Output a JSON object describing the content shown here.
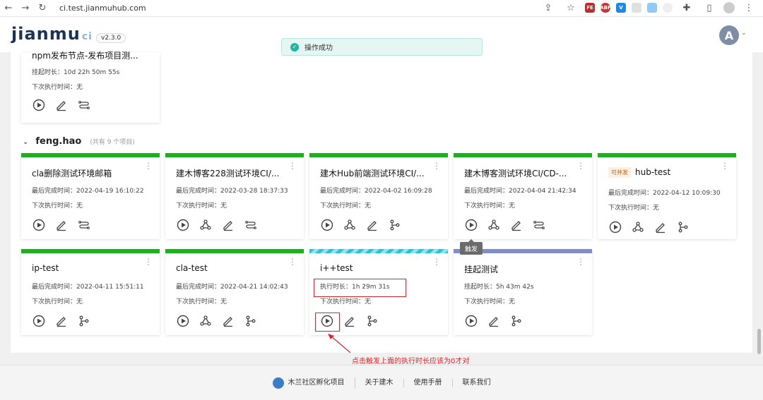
{
  "browser": {
    "url": "ci.test.jianmuhub.com"
  },
  "header": {
    "logo": "jianmu",
    "logo_ci": "ci",
    "version": "v2.3.0",
    "avatar": "A"
  },
  "toast": {
    "text": "操作成功"
  },
  "labels": {
    "last_done": "最后完成时间：",
    "next_run": "下次执行时间：",
    "suspend": "挂起时长：",
    "exec": "执行时长："
  },
  "top_card": {
    "title": "npm发布节点-发布项目测...",
    "suspend": "10d 22h 50m 55s",
    "next": "无"
  },
  "group": {
    "name": "feng.hao",
    "count": "(共有 9 个项目)"
  },
  "cards": [
    {
      "title": "cla删除测试环境邮箱",
      "status": "success",
      "line1_label": "最后完成时间：",
      "line1": "2022-04-19 16:10:22",
      "next": "无",
      "actions": [
        "play",
        "edit",
        "flow"
      ]
    },
    {
      "title": "建木博客228测试环境CI/...",
      "status": "success",
      "line1_label": "最后完成时间：",
      "line1": "2022-03-28 18:37:33",
      "next": "无",
      "actions": [
        "play",
        "webhook",
        "edit",
        "flow"
      ]
    },
    {
      "title": "建木Hub前端测试环境CI/...",
      "status": "success",
      "line1_label": "最后完成时间：",
      "line1": "2022-04-02 16:09:28",
      "next": "无",
      "actions": [
        "play",
        "webhook",
        "edit",
        "branch"
      ]
    },
    {
      "title": "建木博客测试环境CI/CD-...",
      "status": "success",
      "line1_label": "最后完成时间：",
      "line1": "2022-04-04 21:42:34",
      "next": "无",
      "actions": [
        "play",
        "webhook",
        "edit",
        "flow"
      ]
    },
    {
      "title": "hub-test",
      "badge": "可并发",
      "status": "success",
      "line1_label": "最后完成时间：",
      "line1": "2022-04-12 10:09:30",
      "next": "无",
      "actions": [
        "play",
        "webhook",
        "edit",
        "branch"
      ]
    },
    {
      "title": "ip-test",
      "status": "success",
      "line1_label": "最后完成时间：",
      "line1": "2022-04-11 15:51:11",
      "next": "无",
      "actions": [
        "play",
        "edit",
        "branch"
      ]
    },
    {
      "title": "cla-test",
      "status": "success",
      "line1_label": "最后完成时间：",
      "line1": "2022-04-21 14:02:43",
      "next": "无",
      "actions": [
        "play",
        "webhook",
        "edit",
        "branch"
      ]
    },
    {
      "title": "i++test",
      "status": "running",
      "line1_label": "执行时长：",
      "line1": "1h 29m 31s",
      "next": "无",
      "actions": [
        "play",
        "edit",
        "branch"
      ]
    },
    {
      "title": "挂起测试",
      "status": "suspended",
      "line1_label": "挂起时长：",
      "line1": "5h 43m 42s",
      "next": "无",
      "actions": [
        "play",
        "edit",
        "branch"
      ]
    }
  ],
  "tooltip": "触发",
  "annotation": "点击触发上面的执行时长应该为0才对",
  "footer": [
    "木兰社区孵化项目",
    "关于建木",
    "使用手册",
    "联系我们"
  ],
  "colors": {
    "success": "#19b21c",
    "running": "#21c6d9",
    "suspended": "#7f8ec9",
    "annotation": "#d9262b"
  }
}
